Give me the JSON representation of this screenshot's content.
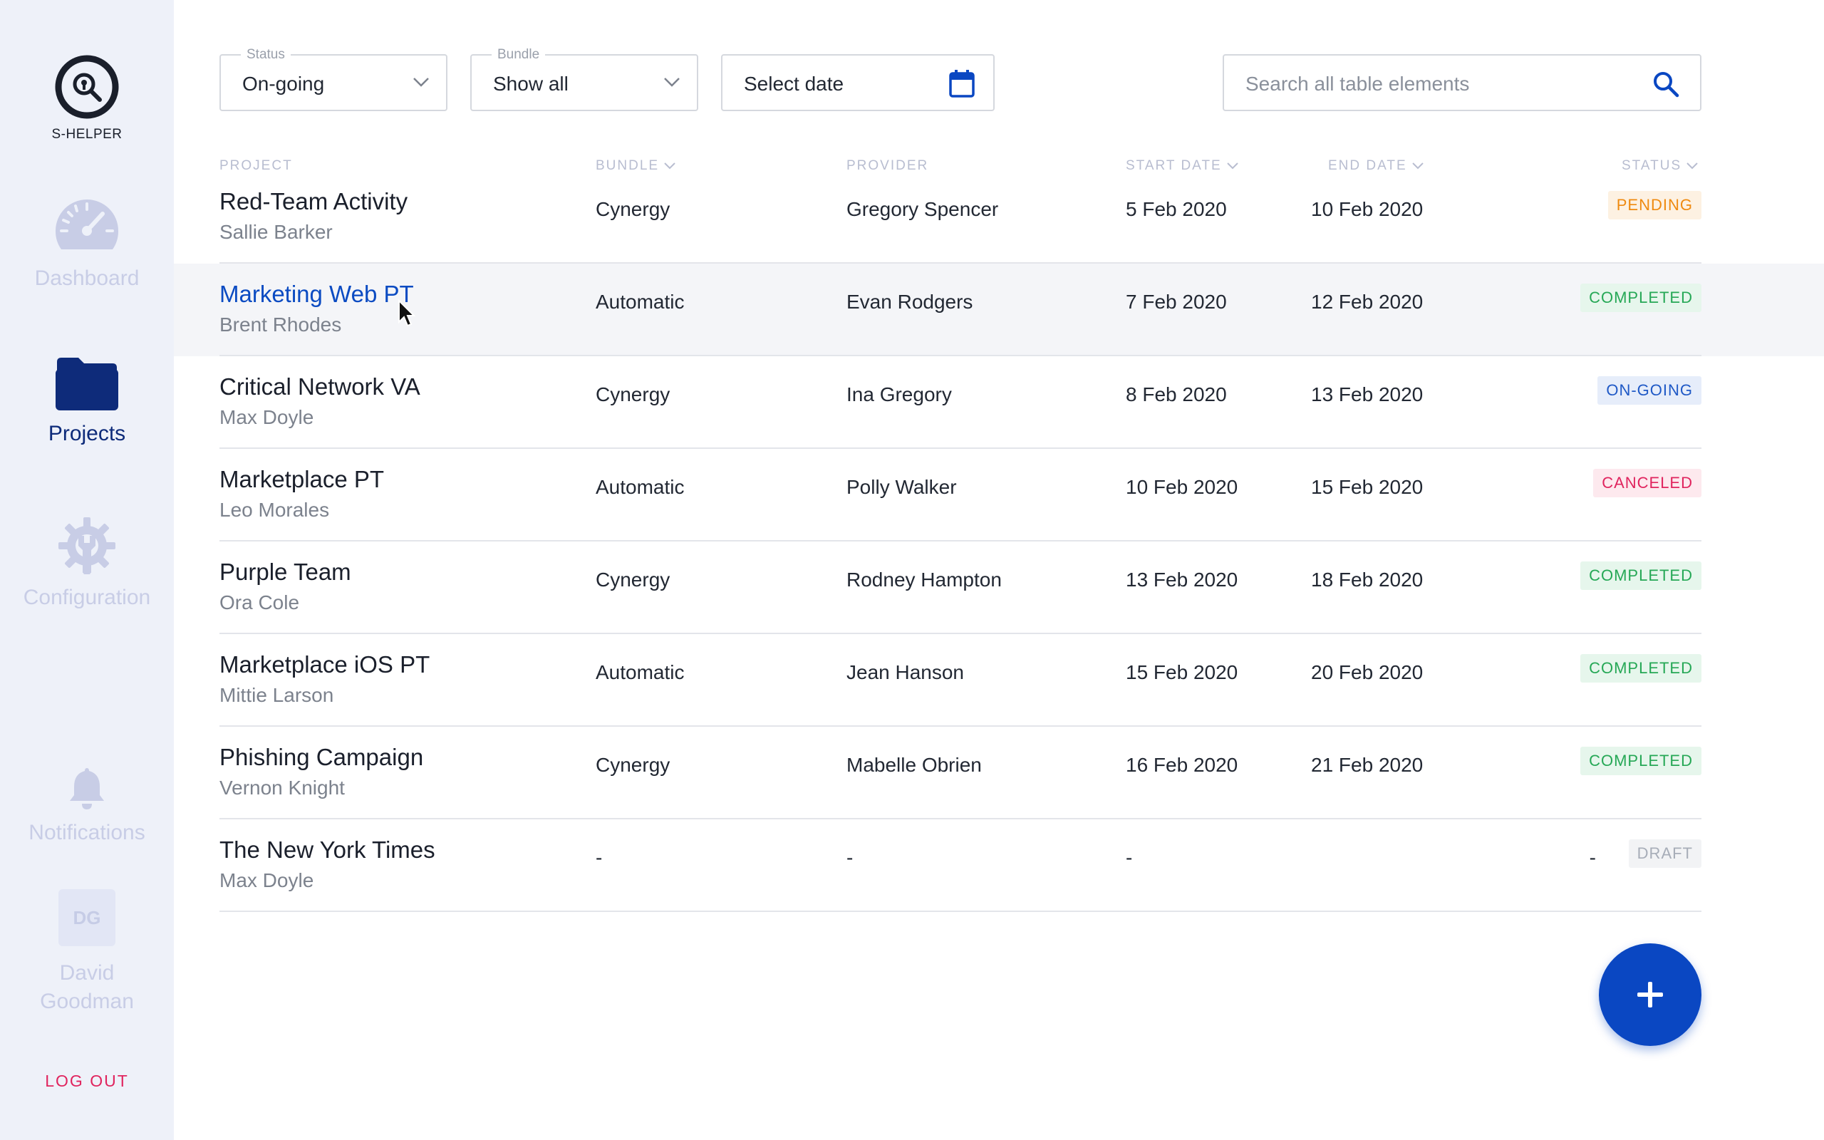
{
  "app": {
    "name": "S-HELPER"
  },
  "sidebar": {
    "items": [
      {
        "label": "Dashboard",
        "icon": "speedometer-icon"
      },
      {
        "label": "Projects",
        "icon": "folder-icon"
      },
      {
        "label": "Configuration",
        "icon": "gear-wrench-icon"
      },
      {
        "label": "Notifications",
        "icon": "bell-icon"
      }
    ],
    "active": "Projects",
    "user": {
      "initials": "DG",
      "name": "David Goodman"
    },
    "logout_label": "LOG OUT"
  },
  "filters": {
    "status": {
      "label": "Status",
      "value": "On-going"
    },
    "bundle": {
      "label": "Bundle",
      "value": "Show all"
    },
    "date": {
      "value": "Select date"
    },
    "search": {
      "placeholder": "Search all table elements"
    }
  },
  "table": {
    "headers": {
      "project": "PROJECT",
      "bundle": "BUNDLE",
      "provider": "PROVIDER",
      "start_date": "START DATE",
      "end_date": "END DATE",
      "status": "STATUS"
    },
    "rows": [
      {
        "title": "Red-Team Activity",
        "owner": "Sallie Barker",
        "bundle": "Cynergy",
        "provider": "Gregory Spencer",
        "start": "5 Feb 2020",
        "end": "10 Feb 2020",
        "status": "PENDING"
      },
      {
        "title": "Marketing Web PT",
        "owner": "Brent Rhodes",
        "bundle": "Automatic",
        "provider": "Evan Rodgers",
        "start": "7 Feb 2020",
        "end": "12 Feb 2020",
        "status": "COMPLETED"
      },
      {
        "title": "Critical Network VA",
        "owner": "Max Doyle",
        "bundle": "Cynergy",
        "provider": "Ina Gregory",
        "start": "8 Feb 2020",
        "end": "13 Feb 2020",
        "status": "ON-GOING"
      },
      {
        "title": "Marketplace PT",
        "owner": "Leo Morales",
        "bundle": "Automatic",
        "provider": "Polly Walker",
        "start": "10 Feb 2020",
        "end": "15 Feb 2020",
        "status": "CANCELED"
      },
      {
        "title": "Purple Team",
        "owner": "Ora Cole",
        "bundle": "Cynergy",
        "provider": "Rodney Hampton",
        "start": "13 Feb 2020",
        "end": "18 Feb 2020",
        "status": "COMPLETED"
      },
      {
        "title": "Marketplace iOS PT",
        "owner": "Mittie Larson",
        "bundle": "Automatic",
        "provider": "Jean Hanson",
        "start": "15 Feb 2020",
        "end": "20 Feb 2020",
        "status": "COMPLETED"
      },
      {
        "title": "Phishing Campaign",
        "owner": "Vernon Knight",
        "bundle": "Cynergy",
        "provider": "Mabelle Obrien",
        "start": "16 Feb 2020",
        "end": "21 Feb 2020",
        "status": "COMPLETED"
      },
      {
        "title": "The New York Times",
        "owner": "Max Doyle",
        "bundle": "-",
        "provider": "-",
        "start": "-",
        "end": "-",
        "status": "DRAFT"
      }
    ]
  },
  "colors": {
    "primary": "#0a47c2",
    "sidebar_bg": "#eef1f9",
    "pending": "#ef8a10",
    "completed": "#26a856",
    "ongoing": "#1f59c6",
    "canceled": "#e0245e",
    "draft": "#a7adb8"
  },
  "fab": {
    "icon": "plus-icon"
  }
}
